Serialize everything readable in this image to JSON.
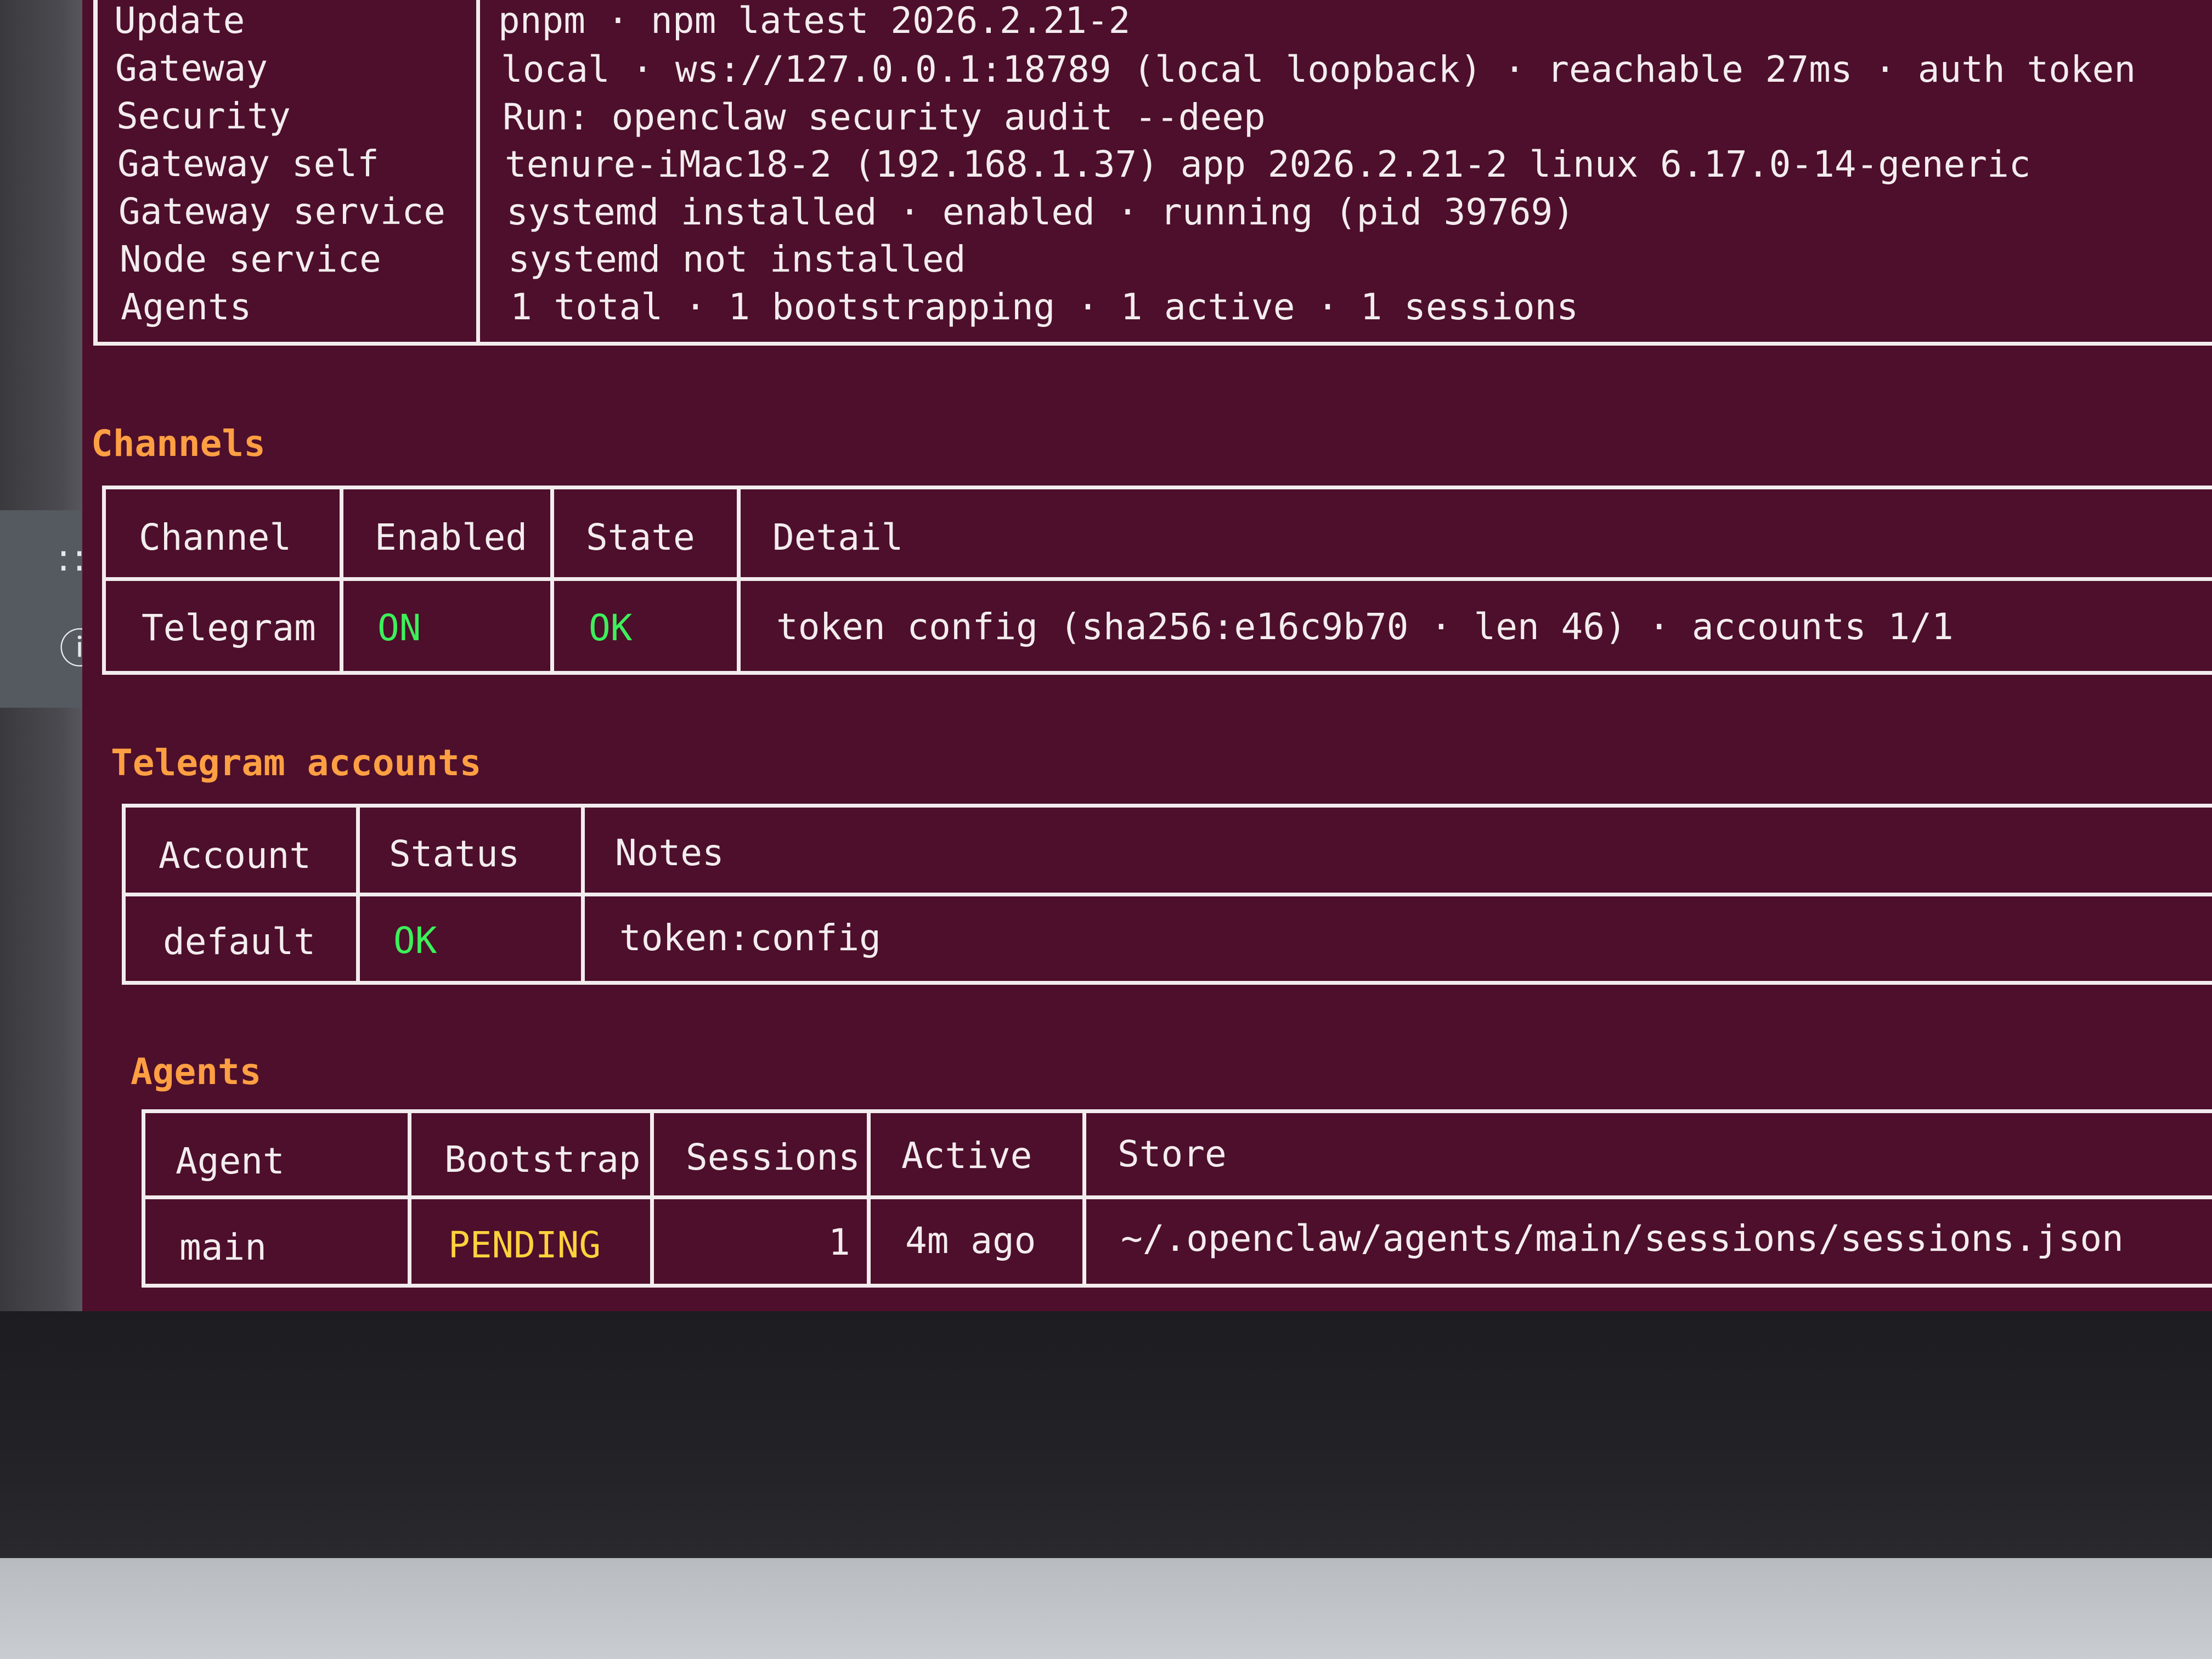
{
  "status": {
    "rows": [
      {
        "label": "Update",
        "value": "pnpm · npm latest 2026.2.21-2"
      },
      {
        "label": "Gateway",
        "value": "local · ws://127.0.0.1:18789 (local loopback) · reachable 27ms · auth token"
      },
      {
        "label": "Security",
        "value": "Run: openclaw security audit --deep"
      },
      {
        "label": "Gateway self",
        "value": "tenure-iMac18-2 (192.168.1.37) app 2026.2.21-2 linux 6.17.0-14-generic"
      },
      {
        "label": "Gateway service",
        "value": "systemd installed · enabled · running (pid 39769)"
      },
      {
        "label": "Node service",
        "value": "systemd not installed"
      },
      {
        "label": "Agents",
        "value": "1 total · 1 bootstrapping · 1 active · 1 sessions"
      }
    ]
  },
  "channels": {
    "title": "Channels",
    "headers": [
      "Channel",
      "Enabled",
      "State",
      "Detail"
    ],
    "rows": [
      {
        "channel": "Telegram",
        "enabled": "ON",
        "state": "OK",
        "detail": "token config (sha256:e16c9b70 · len 46) · accounts 1/1"
      }
    ]
  },
  "telegram_accounts": {
    "title": "Telegram accounts",
    "headers": [
      "Account",
      "Status",
      "Notes"
    ],
    "rows": [
      {
        "account": "default",
        "status": "OK",
        "notes": "token:config"
      }
    ]
  },
  "agents": {
    "title": "Agents",
    "headers": [
      "Agent",
      "Bootstrap",
      "Sessions",
      "Active",
      "Store"
    ],
    "rows": [
      {
        "agent": "main",
        "bootstrap": "PENDING",
        "sessions": "1",
        "active": "4m ago",
        "store": "~/.openclaw/agents/main/sessions/sessions.json"
      }
    ]
  },
  "icons": {
    "apps_grid": "apps-grid-icon",
    "help": "help-circle-icon"
  },
  "colors": {
    "terminal_bg": "#4d0f2b",
    "text": "#f3ecee",
    "section_title": "#ff9f43",
    "ok_green": "#3cf05a",
    "pending_yellow": "#ffd23c"
  }
}
